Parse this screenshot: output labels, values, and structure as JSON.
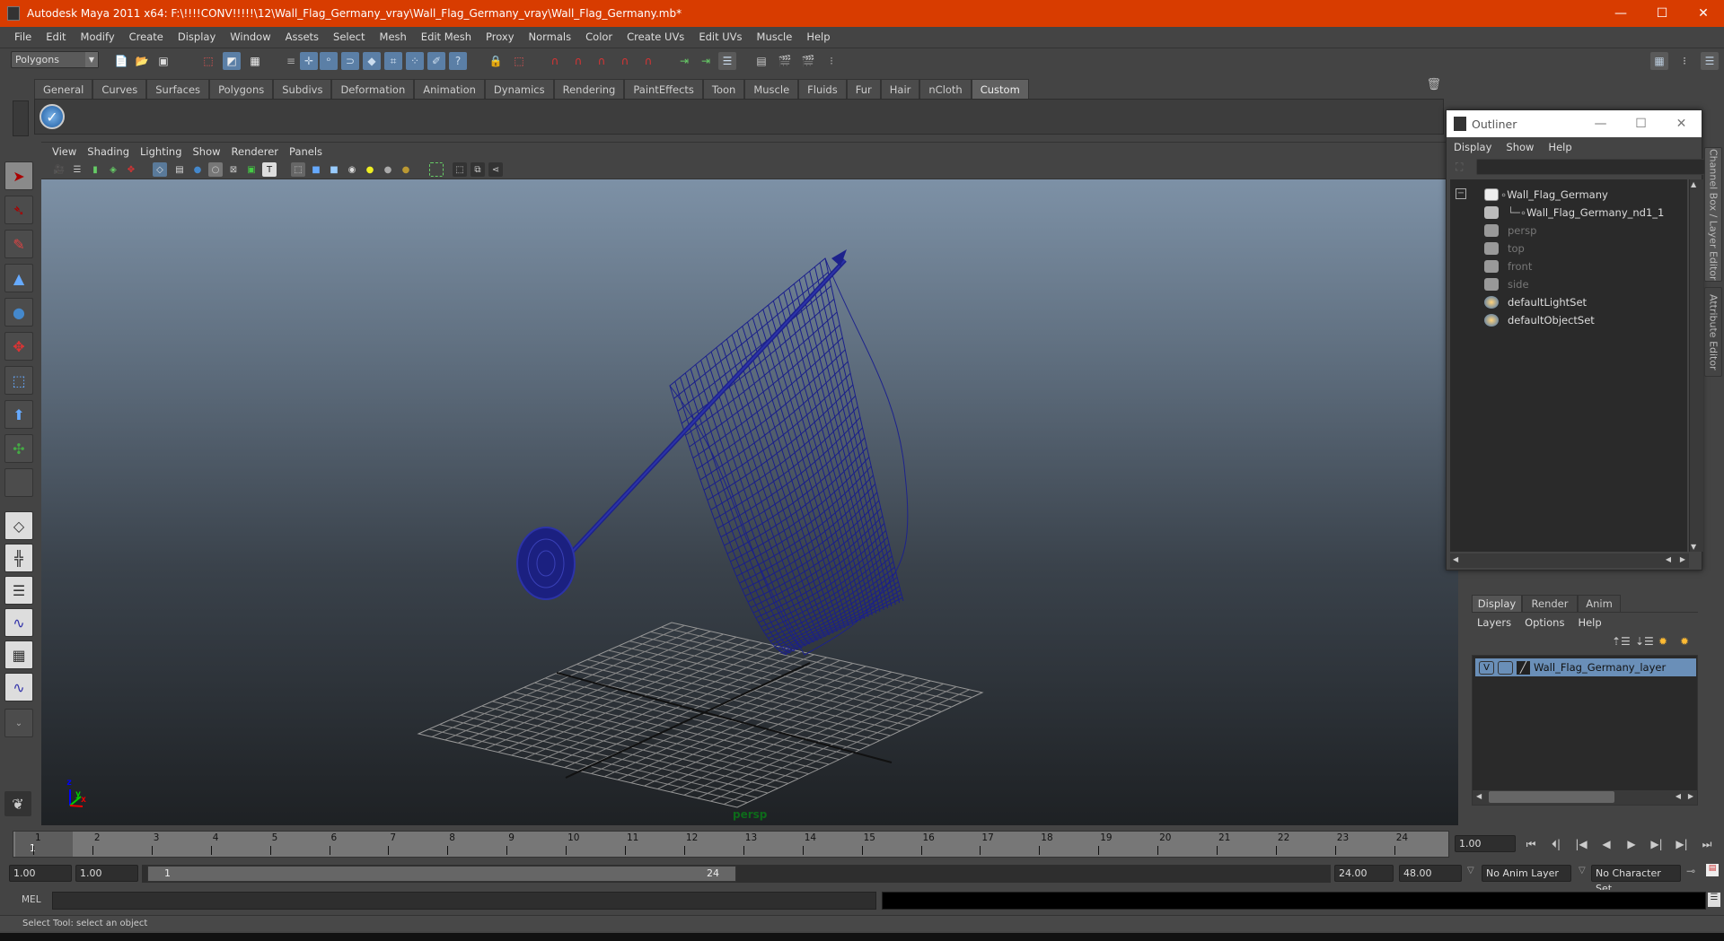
{
  "window": {
    "title": "Autodesk Maya 2011 x64: F:\\!!!!CONV!!!!!\\12\\Wall_Flag_Germany_vray\\Wall_Flag_Germany_vray\\Wall_Flag_Germany.mb*",
    "minimize": "—",
    "maximize": "☐",
    "close": "✕"
  },
  "menubar": [
    "File",
    "Edit",
    "Modify",
    "Create",
    "Display",
    "Window",
    "Assets",
    "Select",
    "Mesh",
    "Edit Mesh",
    "Proxy",
    "Normals",
    "Color",
    "Create UVs",
    "Edit UVs",
    "Muscle",
    "Help"
  ],
  "toolbar": {
    "mode": "Polygons"
  },
  "shelf": {
    "tabs": [
      "General",
      "Curves",
      "Surfaces",
      "Polygons",
      "Subdivs",
      "Deformation",
      "Animation",
      "Dynamics",
      "Rendering",
      "PaintEffects",
      "Toon",
      "Muscle",
      "Fluids",
      "Fur",
      "Hair",
      "nCloth",
      "Custom"
    ],
    "active_tab": "Custom"
  },
  "panel": {
    "menu": [
      "View",
      "Shading",
      "Lighting",
      "Show",
      "Renderer",
      "Panels"
    ],
    "camera_label": "persp",
    "axis": {
      "x": "x",
      "y": "y",
      "z": "z"
    }
  },
  "outliner": {
    "title": "Outliner",
    "menu": [
      "Display",
      "Show",
      "Help"
    ],
    "filter_value": "",
    "items": [
      {
        "label": "Wall_Flag_Germany",
        "icon": "transform-icon",
        "dim": false
      },
      {
        "label": "Wall_Flag_Germany_nd1_1",
        "icon": "mesh-icon",
        "dim": false
      },
      {
        "label": "persp",
        "icon": "camera-icon",
        "dim": true
      },
      {
        "label": "top",
        "icon": "camera-icon",
        "dim": true
      },
      {
        "label": "front",
        "icon": "camera-icon",
        "dim": true
      },
      {
        "label": "side",
        "icon": "camera-icon",
        "dim": true
      },
      {
        "label": "defaultLightSet",
        "icon": "set-icon",
        "dim": false
      },
      {
        "label": "defaultObjectSet",
        "icon": "set-icon",
        "dim": false
      }
    ]
  },
  "side_tabs": [
    "Channel Box / Layer Editor",
    "Attribute Editor"
  ],
  "layer_editor": {
    "tabs": [
      "Display",
      "Render",
      "Anim"
    ],
    "active_tab": "Display",
    "menu": [
      "Layers",
      "Options",
      "Help"
    ],
    "layers": [
      {
        "visible": "V",
        "name": "Wall_Flag_Germany_layer"
      }
    ]
  },
  "timeline": {
    "ticks": [
      "1",
      "2",
      "3",
      "4",
      "5",
      "6",
      "7",
      "8",
      "9",
      "10",
      "11",
      "12",
      "13",
      "14",
      "15",
      "16",
      "17",
      "18",
      "19",
      "20",
      "21",
      "22",
      "23",
      "24"
    ],
    "current_frame_marker": "1",
    "current_time": "1.00"
  },
  "range": {
    "start_time": "1.00",
    "playback_start": "1.00",
    "slider_start": "1",
    "slider_end": "24",
    "playback_end": "24.00",
    "end_time": "48.00",
    "anim_layer": "No Anim Layer",
    "character_set": "No Character Set"
  },
  "mel": {
    "label": "MEL",
    "value": "",
    "result": ""
  },
  "helpline": "Select Tool: select an object",
  "colors": {
    "title_bar": "#d83c00",
    "layer_highlight": "#6a8fb8",
    "panel_bg": "#444444"
  }
}
